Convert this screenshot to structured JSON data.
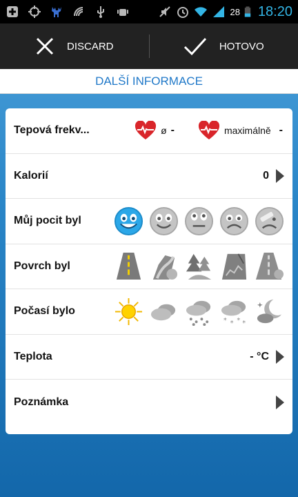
{
  "status": {
    "battery": "28",
    "time": "18:20"
  },
  "action_bar": {
    "discard_label": "DISCARD",
    "done_label": "HOTOVO"
  },
  "section_title": "DALŠÍ INFORMACE",
  "rows": {
    "heart_rate": {
      "label": "Tepová frekv...",
      "avg_symbol": "ø",
      "avg_value": "-",
      "max_label": "maximálně",
      "max_value": "-"
    },
    "calories": {
      "label": "Kalorií",
      "value": "0"
    },
    "feeling": {
      "label": "Můj pocit byl",
      "options": [
        "great-face-icon",
        "smile-face-icon",
        "neutral-face-icon",
        "sad-face-icon",
        "injured-face-icon"
      ],
      "selected": 0
    },
    "surface": {
      "label": "Povrch byl",
      "options": [
        "road-icon",
        "trail-icon",
        "forest-icon",
        "rocky-icon",
        "gravel-road-icon"
      ]
    },
    "weather": {
      "label": "Počasí bylo",
      "options": [
        "sun-icon",
        "cloudy-icon",
        "rain-icon",
        "snow-icon",
        "night-icon"
      ],
      "selected": 0
    },
    "temperature": {
      "label": "Teplota",
      "value": "- °C"
    },
    "note": {
      "label": "Poznámka"
    }
  },
  "colors": {
    "accent": "#1f78c8",
    "selected_face": "#2ba7e8",
    "heart": "#d9252a"
  }
}
